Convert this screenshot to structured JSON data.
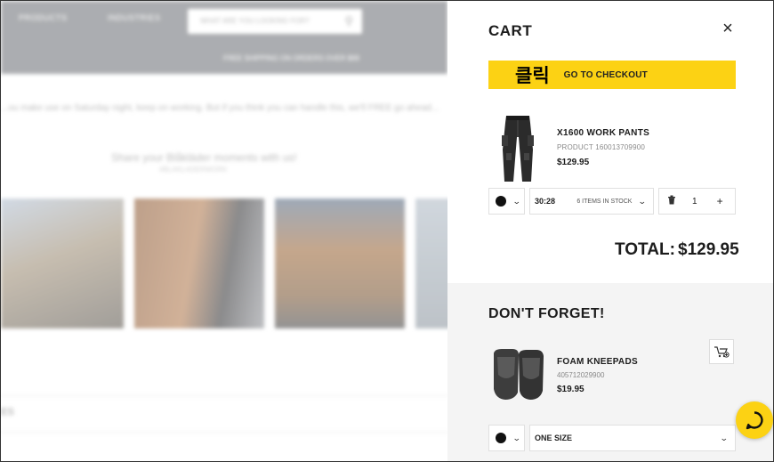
{
  "background": {
    "nav": [
      "PRODUCTS",
      "INDUSTRIES"
    ],
    "search_placeholder": "WHAT ARE YOU LOOKING FOR?",
    "shipping_banner": "FREE SHIPPING ON ORDERS OVER $99",
    "intro_line": "...ou make use on Saturday night, keep on working. But if you think you can handle this, we'll FREE go ahead...",
    "heading": "Share your Blåkläder moments with us!",
    "subheading": "#BLAKLADERWORK",
    "row_label": "ES"
  },
  "cart": {
    "title": "CART",
    "close_icon": "×",
    "checkout_overlay": "클릭",
    "checkout_label": "GO TO CHECKOUT",
    "item": {
      "name": "X1600 WORK PANTS",
      "code": "PRODUCT 160013709900",
      "price": "$129.95",
      "color": "#111111",
      "size": "30:28",
      "stock": "6 ITEMS IN STOCK",
      "quantity": "1",
      "plus": "+"
    },
    "total_label": "TOTAL:",
    "total_value": "$129.95"
  },
  "dont_forget": {
    "title": "DON'T FORGET!",
    "item": {
      "name": "FOAM KNEEPADS",
      "code": "405712029900",
      "price": "$19.95",
      "color": "#111111",
      "size": "ONE SIZE"
    }
  },
  "colors": {
    "accent_yellow": "#fcd214",
    "text_dark": "#1c1c1c"
  }
}
